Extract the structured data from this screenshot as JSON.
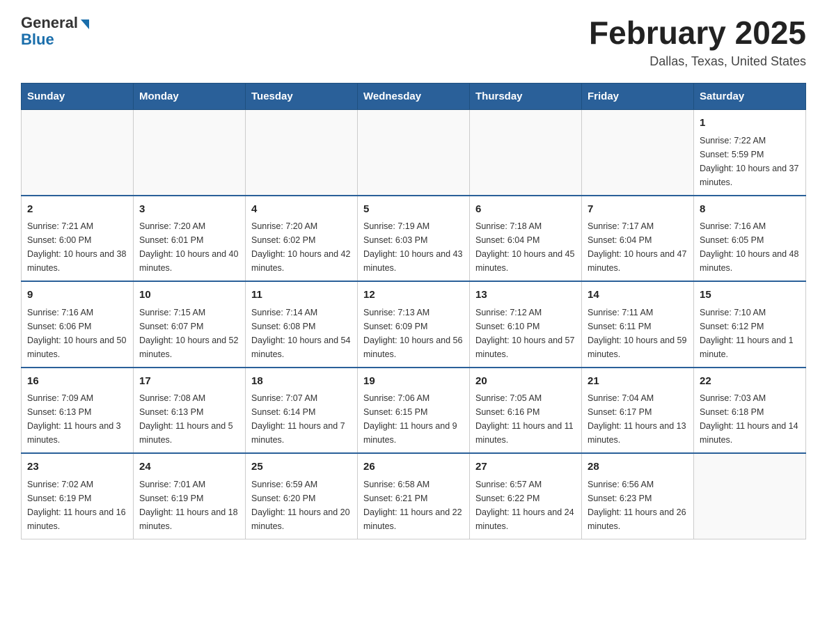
{
  "header": {
    "logo_general": "General",
    "logo_blue": "Blue",
    "month_title": "February 2025",
    "location": "Dallas, Texas, United States"
  },
  "days_of_week": [
    "Sunday",
    "Monday",
    "Tuesday",
    "Wednesday",
    "Thursday",
    "Friday",
    "Saturday"
  ],
  "weeks": [
    [
      {
        "day": "",
        "info": ""
      },
      {
        "day": "",
        "info": ""
      },
      {
        "day": "",
        "info": ""
      },
      {
        "day": "",
        "info": ""
      },
      {
        "day": "",
        "info": ""
      },
      {
        "day": "",
        "info": ""
      },
      {
        "day": "1",
        "info": "Sunrise: 7:22 AM\nSunset: 5:59 PM\nDaylight: 10 hours and 37 minutes."
      }
    ],
    [
      {
        "day": "2",
        "info": "Sunrise: 7:21 AM\nSunset: 6:00 PM\nDaylight: 10 hours and 38 minutes."
      },
      {
        "day": "3",
        "info": "Sunrise: 7:20 AM\nSunset: 6:01 PM\nDaylight: 10 hours and 40 minutes."
      },
      {
        "day": "4",
        "info": "Sunrise: 7:20 AM\nSunset: 6:02 PM\nDaylight: 10 hours and 42 minutes."
      },
      {
        "day": "5",
        "info": "Sunrise: 7:19 AM\nSunset: 6:03 PM\nDaylight: 10 hours and 43 minutes."
      },
      {
        "day": "6",
        "info": "Sunrise: 7:18 AM\nSunset: 6:04 PM\nDaylight: 10 hours and 45 minutes."
      },
      {
        "day": "7",
        "info": "Sunrise: 7:17 AM\nSunset: 6:04 PM\nDaylight: 10 hours and 47 minutes."
      },
      {
        "day": "8",
        "info": "Sunrise: 7:16 AM\nSunset: 6:05 PM\nDaylight: 10 hours and 48 minutes."
      }
    ],
    [
      {
        "day": "9",
        "info": "Sunrise: 7:16 AM\nSunset: 6:06 PM\nDaylight: 10 hours and 50 minutes."
      },
      {
        "day": "10",
        "info": "Sunrise: 7:15 AM\nSunset: 6:07 PM\nDaylight: 10 hours and 52 minutes."
      },
      {
        "day": "11",
        "info": "Sunrise: 7:14 AM\nSunset: 6:08 PM\nDaylight: 10 hours and 54 minutes."
      },
      {
        "day": "12",
        "info": "Sunrise: 7:13 AM\nSunset: 6:09 PM\nDaylight: 10 hours and 56 minutes."
      },
      {
        "day": "13",
        "info": "Sunrise: 7:12 AM\nSunset: 6:10 PM\nDaylight: 10 hours and 57 minutes."
      },
      {
        "day": "14",
        "info": "Sunrise: 7:11 AM\nSunset: 6:11 PM\nDaylight: 10 hours and 59 minutes."
      },
      {
        "day": "15",
        "info": "Sunrise: 7:10 AM\nSunset: 6:12 PM\nDaylight: 11 hours and 1 minute."
      }
    ],
    [
      {
        "day": "16",
        "info": "Sunrise: 7:09 AM\nSunset: 6:13 PM\nDaylight: 11 hours and 3 minutes."
      },
      {
        "day": "17",
        "info": "Sunrise: 7:08 AM\nSunset: 6:13 PM\nDaylight: 11 hours and 5 minutes."
      },
      {
        "day": "18",
        "info": "Sunrise: 7:07 AM\nSunset: 6:14 PM\nDaylight: 11 hours and 7 minutes."
      },
      {
        "day": "19",
        "info": "Sunrise: 7:06 AM\nSunset: 6:15 PM\nDaylight: 11 hours and 9 minutes."
      },
      {
        "day": "20",
        "info": "Sunrise: 7:05 AM\nSunset: 6:16 PM\nDaylight: 11 hours and 11 minutes."
      },
      {
        "day": "21",
        "info": "Sunrise: 7:04 AM\nSunset: 6:17 PM\nDaylight: 11 hours and 13 minutes."
      },
      {
        "day": "22",
        "info": "Sunrise: 7:03 AM\nSunset: 6:18 PM\nDaylight: 11 hours and 14 minutes."
      }
    ],
    [
      {
        "day": "23",
        "info": "Sunrise: 7:02 AM\nSunset: 6:19 PM\nDaylight: 11 hours and 16 minutes."
      },
      {
        "day": "24",
        "info": "Sunrise: 7:01 AM\nSunset: 6:19 PM\nDaylight: 11 hours and 18 minutes."
      },
      {
        "day": "25",
        "info": "Sunrise: 6:59 AM\nSunset: 6:20 PM\nDaylight: 11 hours and 20 minutes."
      },
      {
        "day": "26",
        "info": "Sunrise: 6:58 AM\nSunset: 6:21 PM\nDaylight: 11 hours and 22 minutes."
      },
      {
        "day": "27",
        "info": "Sunrise: 6:57 AM\nSunset: 6:22 PM\nDaylight: 11 hours and 24 minutes."
      },
      {
        "day": "28",
        "info": "Sunrise: 6:56 AM\nSunset: 6:23 PM\nDaylight: 11 hours and 26 minutes."
      },
      {
        "day": "",
        "info": ""
      }
    ]
  ]
}
